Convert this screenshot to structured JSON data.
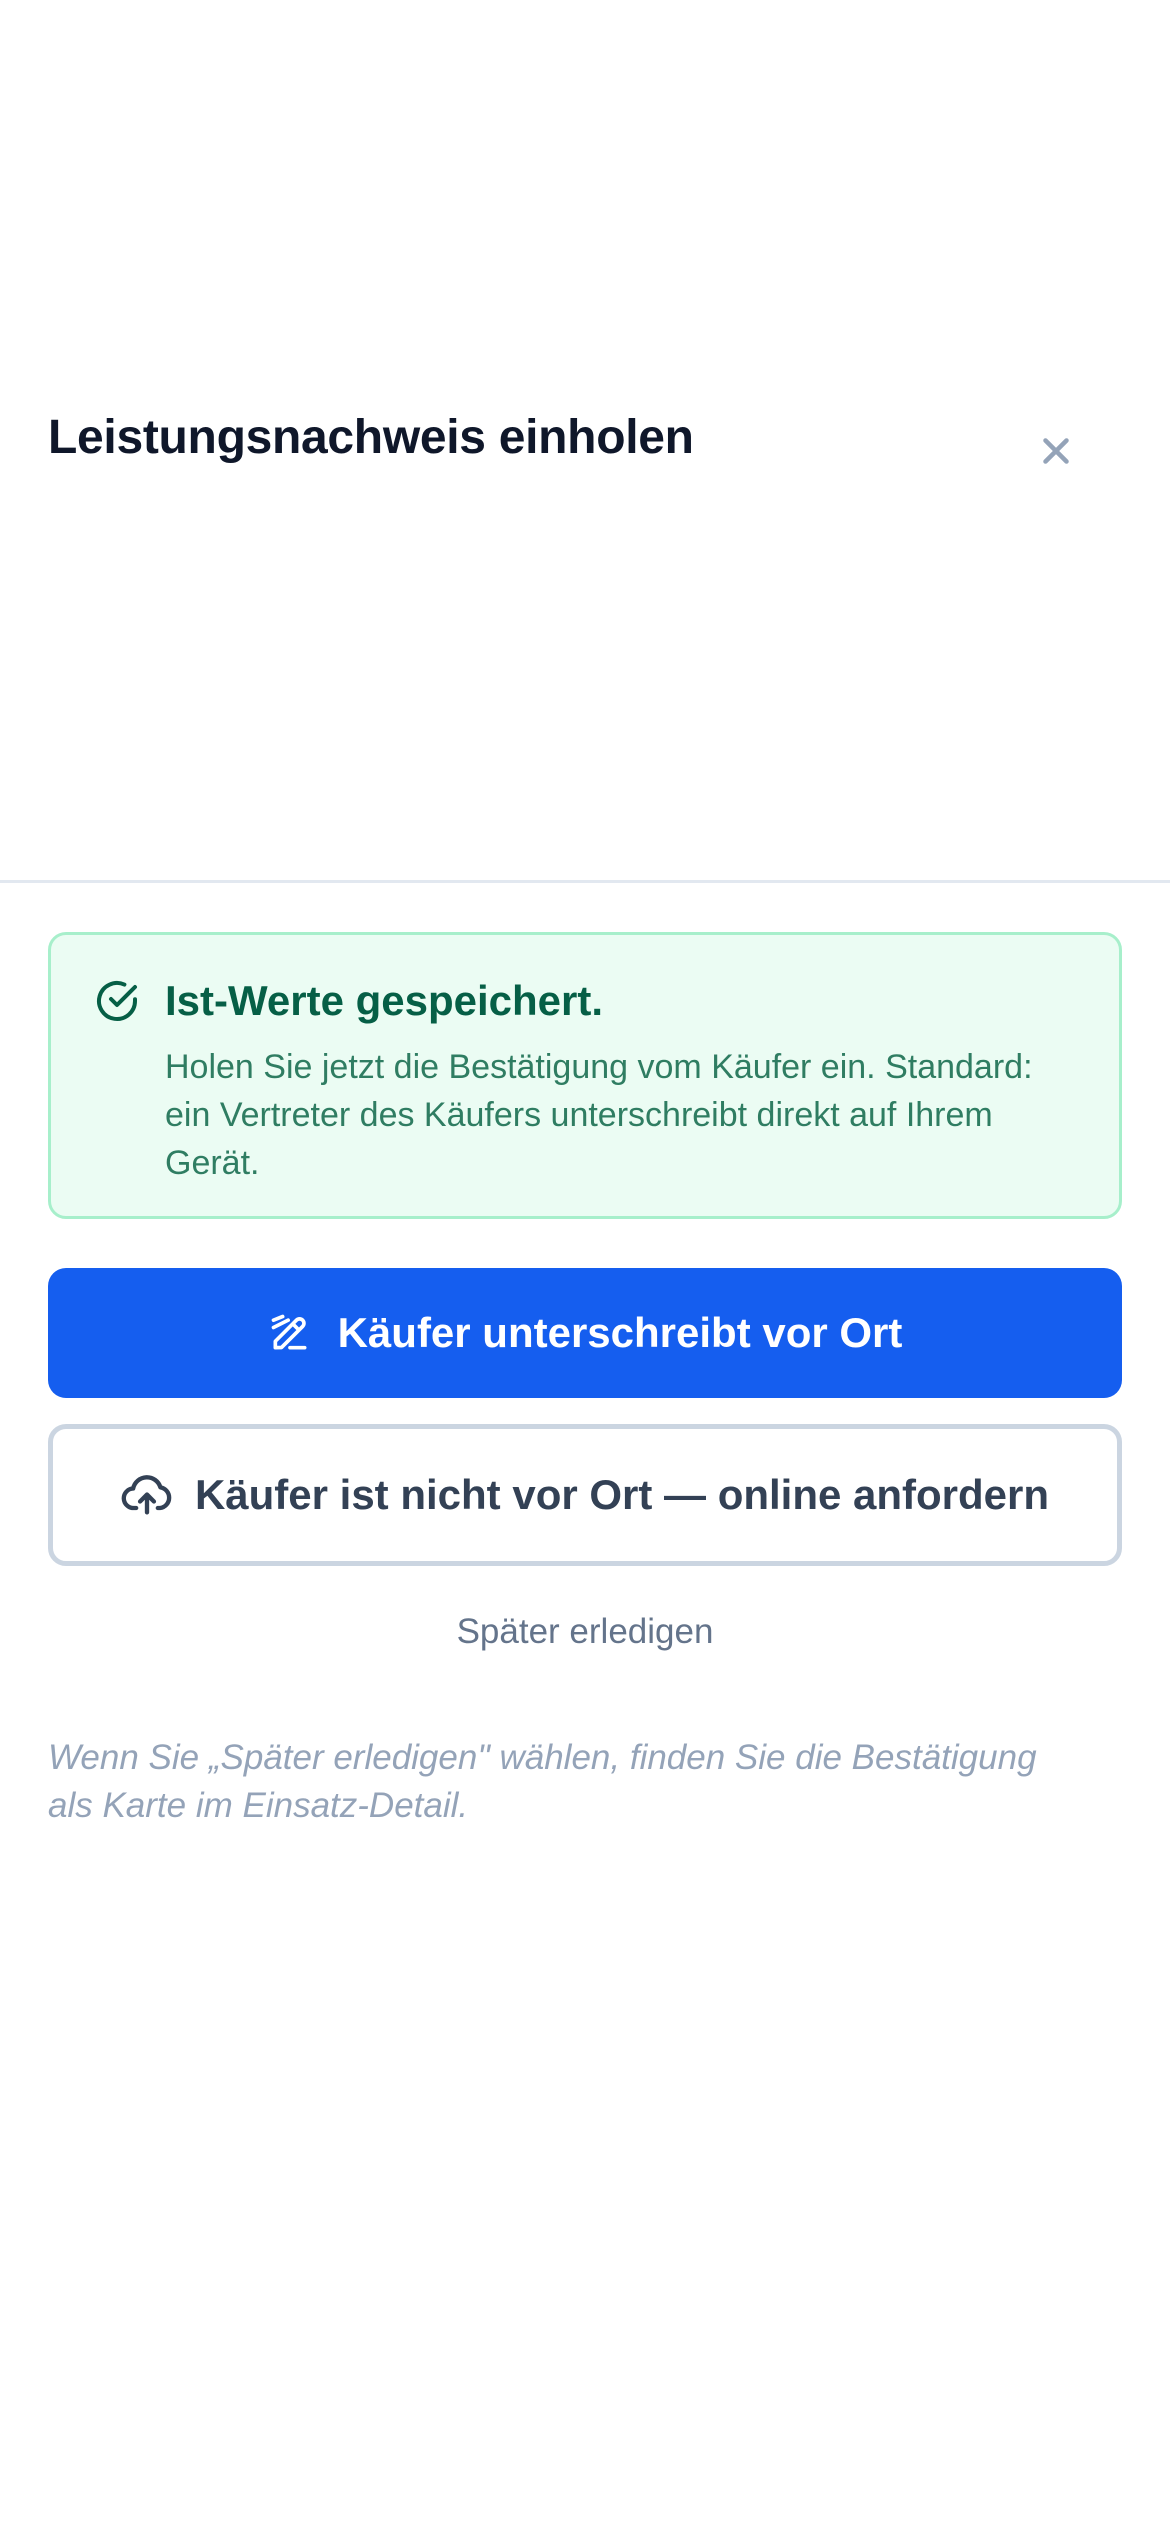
{
  "header": {
    "title": "Leistungsnachweis einholen",
    "close_icon": "close-icon"
  },
  "success_card": {
    "icon": "check-circle-icon",
    "title": "Ist-Werte gespeichert.",
    "body": "Holen Sie jetzt die Bestätigung vom Käufer ein. Standard: ein Vertreter des Käufers unterschreibt direkt auf Ihrem Gerät."
  },
  "actions": {
    "primary_icon": "signature-icon",
    "primary_label": "Käufer unterschreibt vor Ort",
    "secondary_icon": "cloud-upload-icon",
    "secondary_label": "Käufer ist nicht vor Ort — online anfordern",
    "later_label": "Später erledigen"
  },
  "note": "Wenn Sie „Später erledigen\" wählen, finden Sie die Bestätigung als Karte im Einsatz-Detail.",
  "colors": {
    "primary": "#155eef",
    "success_bg": "#ebfcf3",
    "success_border": "#a7efcb",
    "success_text": "#065f46",
    "title_text": "#0f172a",
    "muted_text": "#64748b"
  }
}
